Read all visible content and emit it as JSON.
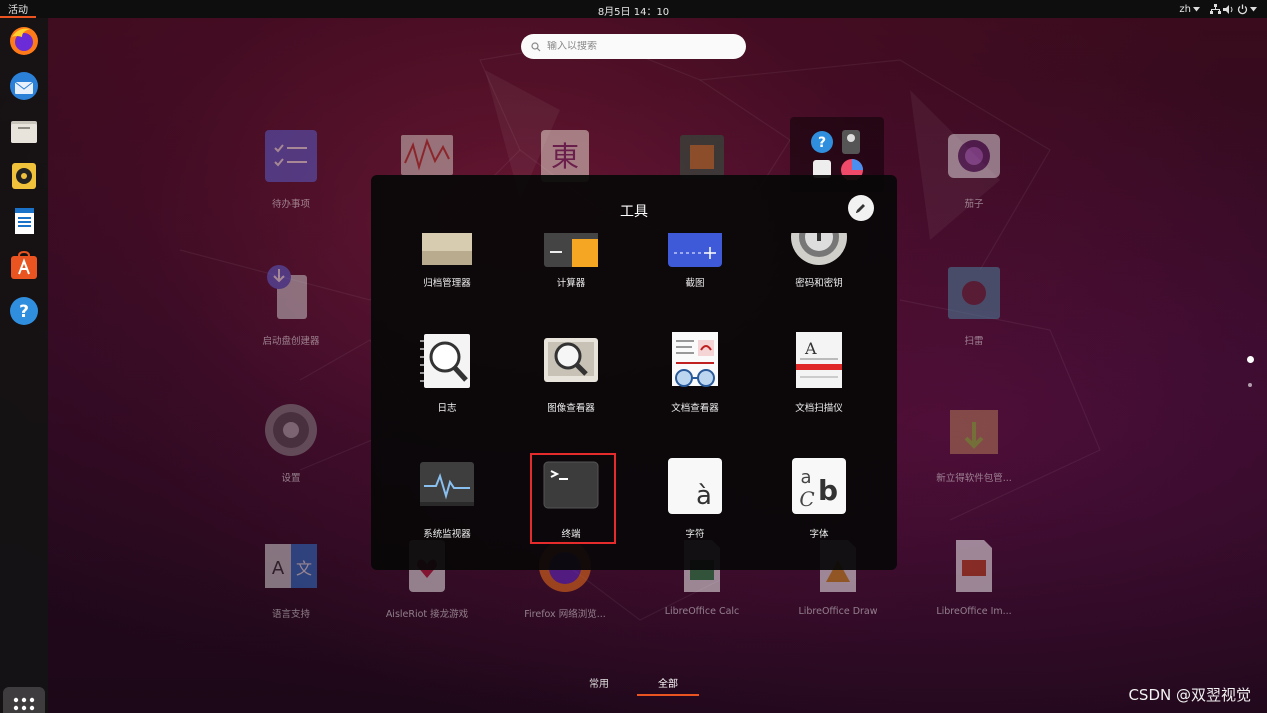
{
  "topbar": {
    "activities": "活动",
    "clock": "8月5日  14：10",
    "lang": "zh"
  },
  "search": {
    "placeholder": "输入以搜索"
  },
  "background_apps": [
    "待办事项",
    "茄子",
    "启动盘创建器",
    "扫雷",
    "设置",
    "新立得软件包管...",
    "语言支持",
    "AisleRiot 接龙游戏",
    "Firefox 网络浏览...",
    "LibreOffice Calc",
    "LibreOffice Draw",
    "LibreOffice Im..."
  ],
  "folder": {
    "title": "工具",
    "row_top": [
      "归档管理器",
      "计算器",
      "截图",
      "密码和密钥"
    ],
    "row_mid": [
      "日志",
      "图像查看器",
      "文档查看器",
      "文档扫描仪"
    ],
    "row_bot": [
      "系统监视器",
      "终端",
      "字符",
      "字体"
    ]
  },
  "tabs": {
    "frequent": "常用",
    "all": "全部"
  },
  "watermark": "CSDN @双翌视觉",
  "colors": {
    "accent": "#e95420",
    "highlight": "#e52b2b"
  }
}
